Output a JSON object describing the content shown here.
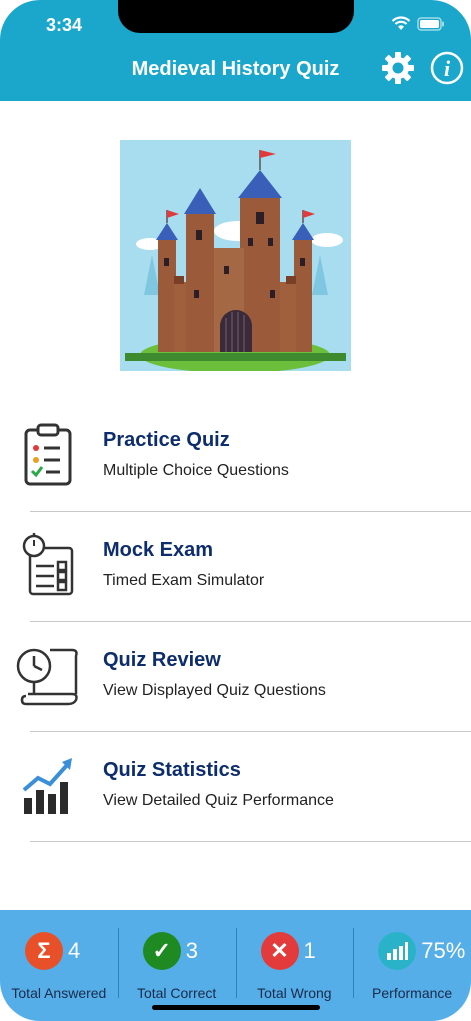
{
  "status_bar": {
    "time": "3:34"
  },
  "header": {
    "title": "Medieval History Quiz",
    "settings_icon": "gear-icon",
    "info_icon": "info-icon"
  },
  "menu": [
    {
      "title": "Practice Quiz",
      "subtitle": "Multiple Choice Questions",
      "icon": "clipboard-checklist-icon"
    },
    {
      "title": "Mock Exam",
      "subtitle": "Timed Exam Simulator",
      "icon": "stopwatch-checklist-icon"
    },
    {
      "title": "Quiz Review",
      "subtitle": "View Displayed Quiz Questions",
      "icon": "clock-scroll-icon"
    },
    {
      "title": "Quiz Statistics",
      "subtitle": "View Detailed Quiz Performance",
      "icon": "bar-chart-trend-icon"
    }
  ],
  "stats": [
    {
      "label": "Total Answered",
      "value": "4",
      "icon": "sigma-icon",
      "color": "#e8502a",
      "glyph": "Σ"
    },
    {
      "label": "Total Correct",
      "value": "3",
      "icon": "checkmark-icon",
      "color": "#1f8a22",
      "glyph": "✓"
    },
    {
      "label": "Total Wrong",
      "value": "1",
      "icon": "cross-icon",
      "color": "#e33b3b",
      "glyph": "✕"
    },
    {
      "label": "Performance",
      "value": "75%",
      "icon": "performance-chart-icon",
      "color": "#2ab3c8",
      "glyph": ""
    }
  ],
  "colors": {
    "header": "#1ba7cc",
    "stats_bar": "#55aee8",
    "menu_title": "#0d2d6c"
  }
}
